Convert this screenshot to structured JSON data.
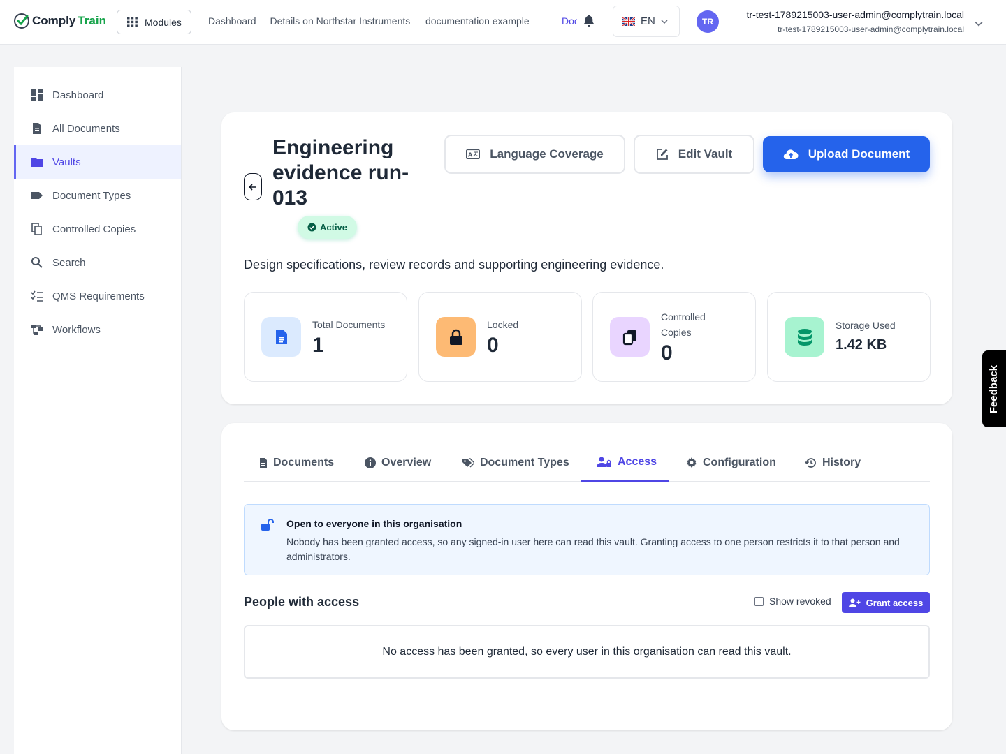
{
  "app": {
    "logo_part1": "Comply",
    "logo_part2": "Train",
    "modules_label": "Modules"
  },
  "breadcrumbs": {
    "items": [
      "Dashboard",
      "Details on Northstar Instruments — documentation example"
    ],
    "current": "Documents"
  },
  "language": {
    "code": "EN",
    "flag": "uk-flag-icon"
  },
  "user": {
    "initials": "TR",
    "name": "tr-test-1789215003-user-admin@complytrain.local",
    "email": "tr-test-1789215003-user-admin@complytrain.local"
  },
  "sidebar": {
    "items": [
      {
        "label": "Dashboard",
        "icon": "dashboard-icon"
      },
      {
        "label": "All Documents",
        "icon": "document-icon"
      },
      {
        "label": "Vaults",
        "icon": "folder-icon",
        "active": true
      },
      {
        "label": "Document Types",
        "icon": "tag-icon"
      },
      {
        "label": "Controlled Copies",
        "icon": "copy-icon"
      },
      {
        "label": "Search",
        "icon": "search-icon"
      },
      {
        "label": "QMS Requirements",
        "icon": "checklist-icon"
      },
      {
        "label": "Workflows",
        "icon": "workflow-icon"
      }
    ]
  },
  "vault": {
    "title": "Engineering evidence run-013",
    "status": "Active",
    "description": "Design specifications, review records and supporting engineering evidence."
  },
  "header_buttons": {
    "language_coverage": "Language Coverage",
    "edit_vault": "Edit Vault",
    "upload_document": "Upload Document"
  },
  "stats": [
    {
      "label": "Total Documents",
      "value": "1",
      "icon": "file-icon",
      "color": "#2563eb"
    },
    {
      "label": "Locked",
      "value": "0",
      "icon": "lock-icon",
      "color": "#f97316"
    },
    {
      "label": "Controlled Copies",
      "value": "0",
      "icon": "copies-icon",
      "color": "#9333ea"
    },
    {
      "label": "Storage Used",
      "value": "1.42 KB",
      "icon": "database-icon",
      "color": "#10b981"
    }
  ],
  "tabs": [
    {
      "label": "Documents",
      "icon": "file-icon"
    },
    {
      "label": "Overview",
      "icon": "info-icon"
    },
    {
      "label": "Document Types",
      "icon": "tags-icon"
    },
    {
      "label": "Access",
      "icon": "user-lock-icon",
      "active": true
    },
    {
      "label": "Configuration",
      "icon": "gear-icon"
    },
    {
      "label": "History",
      "icon": "history-icon"
    }
  ],
  "access": {
    "info_title": "Open to everyone in this organisation",
    "info_text": "Nobody has been granted access, so any signed-in user here can read this vault. Granting access to one person restricts it to that person and administrators.",
    "people_title": "People with access",
    "show_revoked": "Show revoked",
    "show_revoked_checked": false,
    "grant_button": "Grant access",
    "empty_text": "No access has been granted, so every user in this organisation can read this vault."
  },
  "feedback_label": "Feedback",
  "colors": {
    "accent": "#4f46e5",
    "primary": "#2563eb",
    "success": "#10b981"
  }
}
